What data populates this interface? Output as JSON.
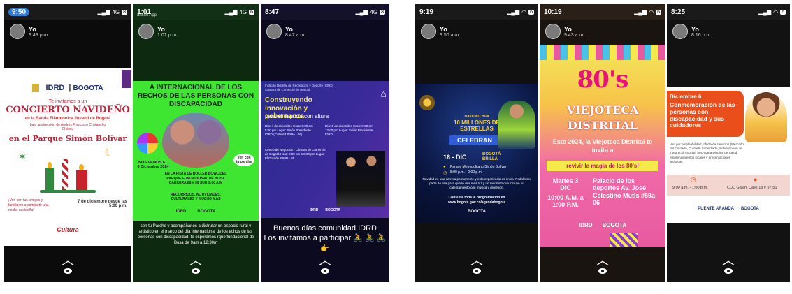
{
  "phones": [
    {
      "status": {
        "time": "9:50",
        "signal": "4G",
        "battery": "8"
      },
      "user": {
        "name": "Yo",
        "time": "9:48 p.m."
      },
      "poster": {
        "logos": [
          "IDRD",
          "BOGOTA"
        ],
        "invite": "Te invitamos a un",
        "title": "CONCIERTO NAVIDEÑO",
        "subtitle": "en la Banda Filarmónica Juvenil de Bogotá",
        "director": "bajo la dirección de Andrés Francisco Cristancho Chávez",
        "place": "en el Parque Simón Bolívar",
        "promo": "¡Ven con tus amigos y familiares a compartir una noche navideña!",
        "date": "7 de diciembre desde las 5:00 p.m.",
        "sponsor": "Cultura"
      }
    },
    {
      "status": {
        "time": "1:01",
        "sub": "ansMi App",
        "signal": "4G",
        "battery": "6"
      },
      "user": {
        "name": "Yo",
        "time": "1:01 p.m."
      },
      "poster": {
        "title": "A INTERNACIONAL DE LOS RECHOS DE LAS PERSONAS CON DISCAPACIDAD",
        "date_badge": "NOS VEMOS EL 6 Diciembre 2024",
        "right_badge": "Ven con tu parche",
        "place": "EN LA PISTA DE ROLLER BOWL DEL PARQUE FUNDACIONAL DE BOSA CARRERA 88 # 59 SUR 9:00 A.M",
        "activities": "RECORRIDOS, ACTIVIDADES, CULTURALES Y MUCHO MÁS",
        "logos": [
          "IDRD",
          "BOGOTA"
        ]
      },
      "caption": "con tu Parche y acompáñanos a disfrutar un espacio rural y artístico en el marco del día internacional de los echos de las personas con discapacidad, te esperamos rque fundacional de Bosa de 9am a 12:30m"
    },
    {
      "status": {
        "time": "8:47",
        "signal": "4G",
        "battery": "8"
      },
      "user": {
        "name": "Yo",
        "time": "8:47 a.m."
      },
      "poster": {
        "org": "Instituto Distrital de Recreación y Deporte (IDRD) Cámara de Comercio de Bogotá",
        "title": "Construyendo innovación y gobernanza",
        "subtitle": "para el deporte con altura",
        "left_info": "Día: 4 de diciembre Hora: 8:00 am - 5:00 pm Lugar: Salón Presidente IDRD (Calle 63 # 59a - 06)",
        "right_info": "Día: 5 de diciembre Hora: 8:00 am - 12:00 pm Lugar: Salón Presidente IDRD",
        "center": "Centro de Negocios - Cámara de Comercio de Bogotá Hora: 2:00 pm a 5:00 pm Lugar: El Dorado # 68D - 35",
        "logos": [
          "IDRD",
          "BOGOTA"
        ]
      },
      "caption": "Buenos días comunidad IDRD\nLos invitamos a participar 🚴 🚴 🚴 👉"
    },
    {
      "status": {
        "time": "9:19",
        "signal": "",
        "battery": "6"
      },
      "user": {
        "name": "Yo",
        "time": "9:50 a.m."
      },
      "poster": {
        "top": "NAVIDAD 2024",
        "title": "10 MILLONES DE ESTRELLAS",
        "banner": "CELEBRAN",
        "date": "16 - DIC",
        "brand": "BOGOTÁ BRILLA",
        "place": "Parque Metropolitano Simón Bolívar",
        "hour": "8:00 p.m. - 9:00 p.m.",
        "desc": "Navidad es una carrera permanente y esta experiencia es única. Podrás ser parte de ella para que te des más luz y un recorrido que incluye un calentamiento con música y diversión.",
        "link": "Consulta toda la programación en www.bogota.gov.co/agendabogota"
      }
    },
    {
      "status": {
        "time": "10:19",
        "signal": "",
        "battery": "6"
      },
      "user": {
        "name": "Yo",
        "time": "9:43 a.m."
      },
      "poster": {
        "title": "80's",
        "line1": "VIEJOTECA",
        "line2": "DISTRITAL",
        "intro": "Este 2024, la Viejoteca Distrital te invita a",
        "ribbon": "revivir la magia de los 80's!",
        "day": "Martes 3 DIC",
        "hour": "10:00 A.M. a 1:00 P.M.",
        "place": "Palacio de los deportes Av. José Celestino Mutis #59a-06",
        "logos": [
          "IDRD",
          "BOGOTA"
        ]
      }
    },
    {
      "status": {
        "time": "8:25",
        "signal": "",
        "battery": "6"
      },
      "user": {
        "name": "Yo",
        "time": "8:16 p.m."
      },
      "poster": {
        "date": "Diciembre 6",
        "title": "Conmemoración de las personas con discapacidad y sus cuidadores",
        "desc": "Ven por empleabilidad, oferta de servicios (Mercado del Cuidado, Cuidarte Subsidiado, Subdirección de Integración Social, Secretaría Distrital de Salud, emprendimientos locales y presentaciones artísticas.",
        "hour": "9:00 a.m. - 1:00 p.m.",
        "place": "CDC Galán, Calle 1b # 57-51",
        "logos": [
          "PUENTE ARANDA",
          "BOGOTA"
        ]
      }
    }
  ]
}
